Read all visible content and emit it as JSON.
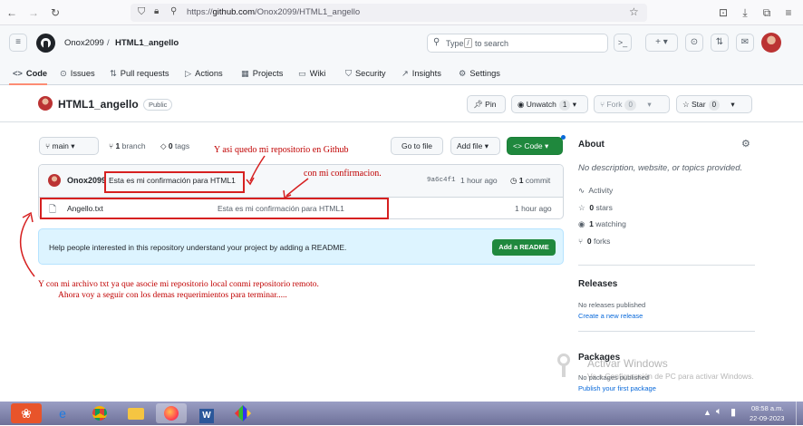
{
  "browser": {
    "url_prefix": "https://",
    "url_host": "github.com",
    "url_path": "/Onox2099/HTML1_angello"
  },
  "header": {
    "owner": "Onox2099",
    "sep": "/",
    "repo": "HTML1_angello",
    "search_placeholder_1": "Type",
    "search_slash": "/",
    "search_placeholder_2": "to search",
    "plus": "+ ▾"
  },
  "tabs": [
    {
      "icon": "<>",
      "label": "Code"
    },
    {
      "icon": "⊙",
      "label": "Issues"
    },
    {
      "icon": "⇅",
      "label": "Pull requests"
    },
    {
      "icon": "▷",
      "label": "Actions"
    },
    {
      "icon": "▦",
      "label": "Projects"
    },
    {
      "icon": "▭",
      "label": "Wiki"
    },
    {
      "icon": "⛉",
      "label": "Security"
    },
    {
      "icon": "↗",
      "label": "Insights"
    },
    {
      "icon": "⚙",
      "label": "Settings"
    }
  ],
  "repo": {
    "name": "HTML1_angello",
    "visibility": "Public",
    "pin": "Pin",
    "unwatch": "Unwatch",
    "unwatch_count": "1",
    "fork": "Fork",
    "fork_count": "0",
    "star": "Star",
    "star_count": "0"
  },
  "toolbar": {
    "branch": "main",
    "branches": "1",
    "branch_label": "branch",
    "tags": "0",
    "tags_label": "tags",
    "goto": "Go to file",
    "addfile": "Add file",
    "code": "Code"
  },
  "commit": {
    "author": "Onox2099",
    "message": "Esta es mi confirmación para HTML1",
    "hash": "9a6c4f1",
    "time": "1 hour ago",
    "count": "1",
    "count_label": "commit"
  },
  "files": [
    {
      "name": "Angello.txt",
      "message": "Esta es mi confirmación para HTML1",
      "time": "1 hour ago"
    }
  ],
  "readme": {
    "text": "Help people interested in this repository understand your project by adding a README.",
    "button": "Add a README"
  },
  "about": {
    "title": "About",
    "desc": "No description, website, or topics provided.",
    "activity": "Activity",
    "stars": "0",
    "stars_l": "stars",
    "watching": "1",
    "watching_l": "watching",
    "forks": "0",
    "forks_l": "forks"
  },
  "releases": {
    "title": "Releases",
    "none": "No releases published",
    "link": "Create a new release"
  },
  "packages": {
    "title": "Packages",
    "none": "No packages published",
    "link": "Publish your first package"
  },
  "annotations": {
    "a1": "Y asi quedo mi repositorio en Github",
    "a2": "con mi confirmacion.",
    "a3": "Y con mi archivo txt ya que asocie mi repositorio local conmi repositorio remoto.",
    "a4": "Ahora voy a seguir con los demas requerimientos para terminar....."
  },
  "watermark": {
    "title": "Activar Windows",
    "sub": "Ve a Configuración de PC para activar Windows."
  },
  "taskbar": {
    "time": "08:58 a.m.",
    "date": "22-09-2023"
  },
  "colors": {
    "accent": "#1f883d",
    "annotation": "#c00000",
    "link": "#0969da"
  }
}
